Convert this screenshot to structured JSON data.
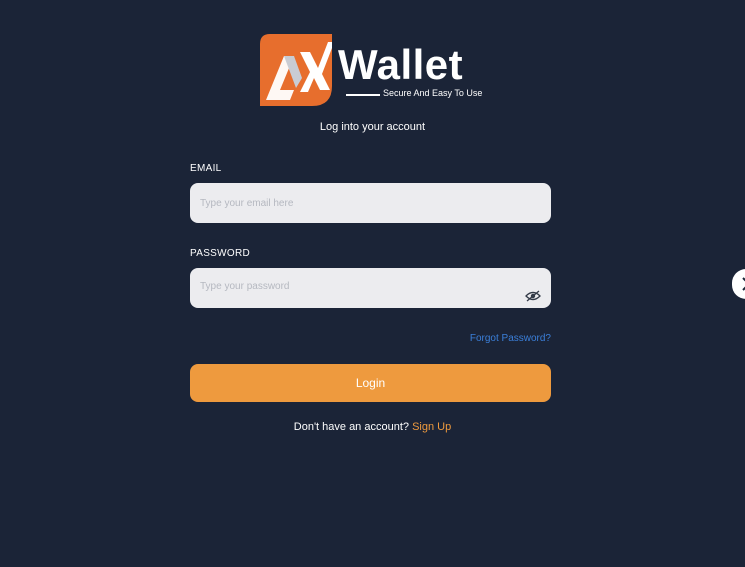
{
  "brand": {
    "name": "Wallet",
    "tagline": "Secure And Easy To Use",
    "logo_icon": "ax-logo-icon",
    "logo_color": "#e76e2d"
  },
  "login": {
    "subtitle": "Log into your account",
    "email_label": "EMAIL",
    "email_placeholder": "Type your email here",
    "password_label": "PASSWORD",
    "password_placeholder": "Type your password",
    "password_toggle_icon": "eye-slash-icon",
    "forgot_link": "Forgot Password?",
    "submit_label": "Login",
    "signup_prompt": "Don't have an account?",
    "signup_link": "Sign Up"
  },
  "side_handle": {
    "icon": "chevron-right-icon"
  },
  "colors": {
    "background": "#1b2437",
    "accent": "#ee9a3e",
    "link": "#3b7fd9",
    "input_bg": "#ececef"
  }
}
